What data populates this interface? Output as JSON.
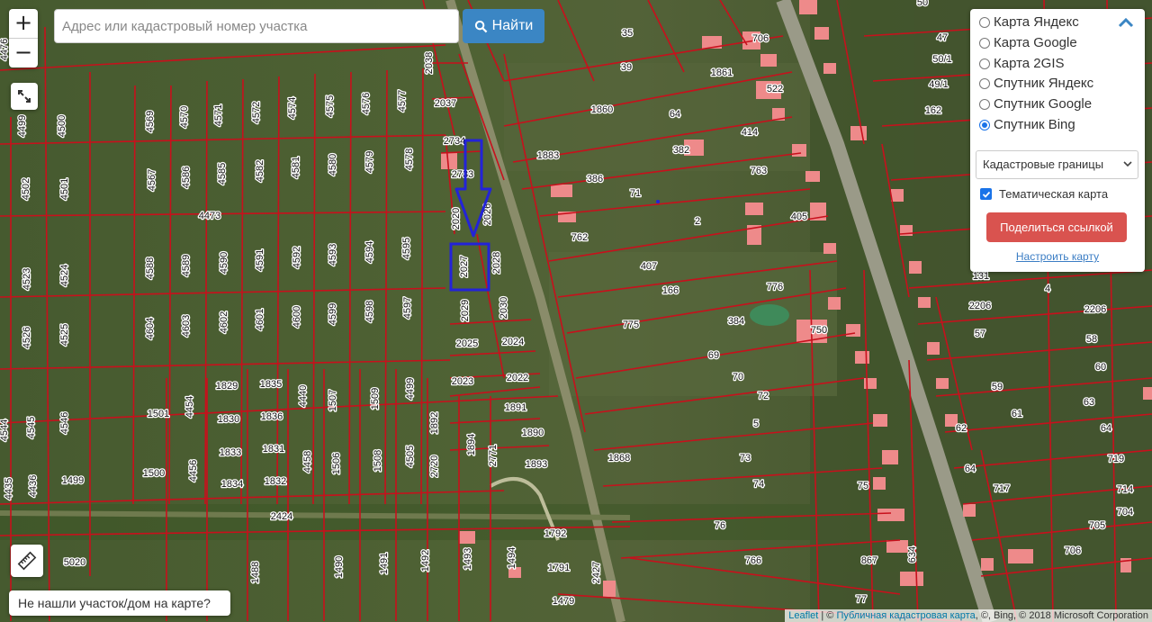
{
  "search": {
    "placeholder": "Адрес или кадастровый номер участка",
    "button_label": "Найти"
  },
  "zoom": {
    "in_label": "+",
    "out_label": "−"
  },
  "layers": {
    "options": [
      "Карта Яндекс",
      "Карта Google",
      "Карта 2GIS",
      "Спутник Яндекс",
      "Спутник Google",
      "Спутник Bing"
    ],
    "selected_index": 5,
    "overlay_select": "Кадастровые границы",
    "thematic_checkbox_label": "Тематическая карта",
    "thematic_checked": true,
    "share_label": "Поделиться ссылкой",
    "configure_label": "Настроить карту"
  },
  "not_found_label": "Не нашли участок/дом на карте?",
  "attribution": {
    "leaflet": "Leaflet",
    "sep": " | © ",
    "cadastre": "Публичная кадастровая карта",
    "rest": ", ©, Bing, © 2018 Microsoft Corporation"
  },
  "colors": {
    "parcel_line": "#c8101c",
    "highlight": "#2323d8",
    "roof": "#ee8a8a"
  },
  "parcel_labels": [
    "4476",
    "4499",
    "4500",
    "4502",
    "4501",
    "4569",
    "4570",
    "4571",
    "4572",
    "4574",
    "4575",
    "4576",
    "4577",
    "4567",
    "4586",
    "4585",
    "4582",
    "4581",
    "4580",
    "4579",
    "4578",
    "4473",
    "4523",
    "4524",
    "4526",
    "4525",
    "4588",
    "4589",
    "4590",
    "4591",
    "4592",
    "4593",
    "4594",
    "4595",
    "4604",
    "4603",
    "4602",
    "4601",
    "4600",
    "4599",
    "4598",
    "4597",
    "2038",
    "2037",
    "2734",
    "2733",
    "2020",
    "2026",
    "2027",
    "2028",
    "2029",
    "2030",
    "2025",
    "2024",
    "2023",
    "2022",
    "1891",
    "1892",
    "1894",
    "1890",
    "1893",
    "2771",
    "2720",
    "4454",
    "4456",
    "1501",
    "1500",
    "1499",
    "1829",
    "1835",
    "1830",
    "1836",
    "1833",
    "1831",
    "1834",
    "1832",
    "4440",
    "4458",
    "1507",
    "1506",
    "1509",
    "1508",
    "4499",
    "4505",
    "4544",
    "4545",
    "4546",
    "4435",
    "4436",
    "2424",
    "5020",
    "1488",
    "1490",
    "1491",
    "1492",
    "1493",
    "1494",
    "1792",
    "1791",
    "1479",
    "2427",
    "35",
    "706",
    "39",
    "1861",
    "522",
    "1860",
    "64",
    "414",
    "1883",
    "382",
    "386",
    "71",
    "763",
    "2",
    "762",
    "407",
    "405",
    "166",
    "776",
    "775",
    "384",
    "750",
    "69",
    "70",
    "72",
    "5",
    "1868",
    "73",
    "74",
    "75",
    "76",
    "766",
    "867",
    "634",
    "77",
    "50",
    "47",
    "50/1",
    "49/1",
    "162",
    "131",
    "4",
    "2206",
    "2206",
    "57",
    "58",
    "60",
    "59",
    "61",
    "63",
    "62",
    "64",
    "64",
    "719",
    "717",
    "714",
    "704",
    "705",
    "706"
  ],
  "map_cursor_mark": ""
}
